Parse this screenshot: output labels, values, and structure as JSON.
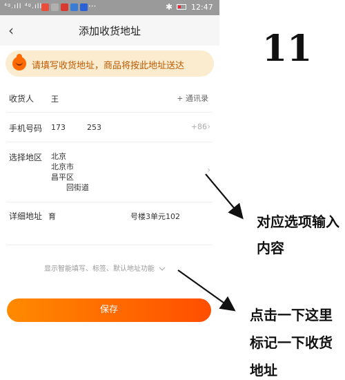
{
  "statusbar": {
    "signal": "⁴ᵍ.ıll ⁴ᵍ.ıll",
    "more": "···",
    "bluetooth": "✱",
    "time": "12:47",
    "app_colors": [
      "#e94e3c",
      "#b0b0b0",
      "#d83a2f",
      "#3a7bd5",
      "#2a62d6"
    ]
  },
  "nav": {
    "back_icon": "‹",
    "title": "添加收货地址"
  },
  "banner": {
    "text": "请填写收货地址，商品将按此地址送达"
  },
  "form": {
    "recipient": {
      "label": "收货人",
      "value": "王",
      "contacts": "+ 通讯录"
    },
    "phone": {
      "label": "手机号码",
      "value_a": "173",
      "value_b": "253",
      "prefix": "+86",
      "chevron": "›"
    },
    "region": {
      "label": "选择地区",
      "lines": [
        "北京",
        "北京市",
        "昌平区",
        "回街道"
      ],
      "chevron": "›"
    },
    "detail": {
      "label": "详细地址",
      "value_a": "育",
      "value_b": "号楼3单元102"
    }
  },
  "smart_fill": {
    "text": "显示智能填写、标签、默认地址功能",
    "icon": "chevron-down"
  },
  "save_label": "保存",
  "annotation": {
    "number": "11",
    "note1_line1": "对应选项输入",
    "note1_line2": "内容",
    "note2_line1": "点击一下这里",
    "note2_line2": "标记一下收货",
    "note2_line3": "地址"
  },
  "colors": {
    "accent": "#ff6a00",
    "banner_bg": "#fbeccf",
    "statusbar": "#9a9a9a"
  }
}
